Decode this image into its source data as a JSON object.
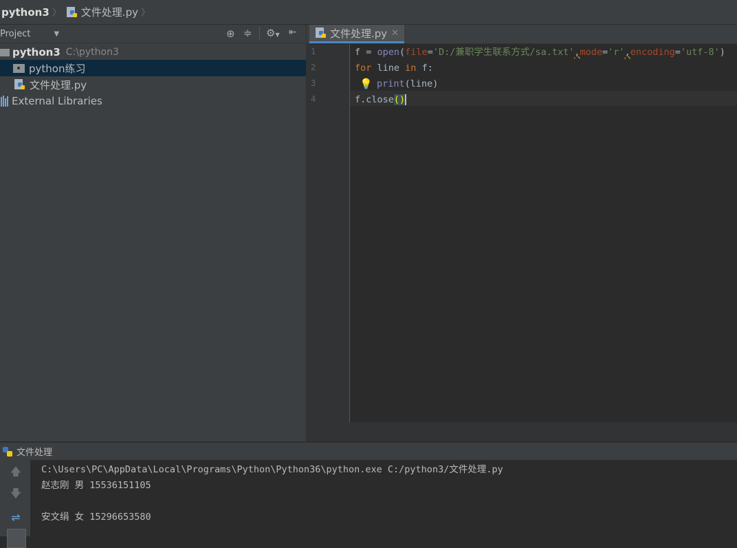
{
  "breadcrumb": {
    "project": "python3",
    "file": "文件处理.py"
  },
  "project_panel": {
    "title": "Project",
    "root": {
      "name": "python3",
      "path": "C:\\python3"
    },
    "items": [
      {
        "label": "python练习",
        "icon": "folder-icon"
      },
      {
        "label": "文件处理.py",
        "icon": "python-file-icon"
      },
      {
        "label": "External Libraries",
        "icon": "libraries-icon"
      }
    ]
  },
  "editor": {
    "tab_label": "文件处理.py",
    "line_numbers": [
      "1",
      "2",
      "3",
      "4"
    ],
    "code": {
      "l1_var": "f = ",
      "l1_open": "open",
      "l1_p1": "(",
      "l1_kw_file": "file",
      "l1_eq1": "=",
      "l1_str1": "'D:/兼职学生联系方式/sa.txt'",
      "l1_c1": ",",
      "l1_kw_mode": "mode",
      "l1_eq2": "=",
      "l1_str2": "'r'",
      "l1_c2": ",",
      "l1_kw_enc": "encoding",
      "l1_eq3": "=",
      "l1_str3": "'utf-8'",
      "l1_p2": ")",
      "l2_for": "for",
      "l2_mid": " line ",
      "l2_in": "in",
      "l2_end": " f:",
      "l3_print": "print",
      "l3_rest": "(line)",
      "l4_close": "f.close",
      "l4_parens": "()"
    }
  },
  "run_panel": {
    "title": "文件处理",
    "output": [
      "C:\\Users\\PC\\AppData\\Local\\Programs\\Python\\Python36\\python.exe C:/python3/文件处理.py",
      "赵志刚 男 15536151105",
      "",
      "安文绢 女 15296653580"
    ]
  },
  "colors": {
    "accent": "#4a88c7",
    "selection": "#0d293e",
    "keyword": "#cc7832",
    "string": "#6a8759",
    "builtin": "#8888c6",
    "param": "#aa4926"
  }
}
